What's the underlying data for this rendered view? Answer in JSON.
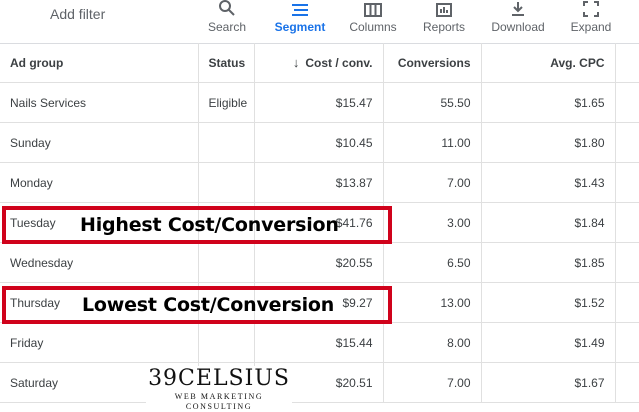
{
  "toolbar": {
    "add_filter": "Add filter",
    "buttons": [
      {
        "label": "Search",
        "icon": "search-icon",
        "active": false
      },
      {
        "label": "Segment",
        "icon": "segment-icon",
        "active": true
      },
      {
        "label": "Columns",
        "icon": "columns-icon",
        "active": false
      },
      {
        "label": "Reports",
        "icon": "reports-icon",
        "active": false
      },
      {
        "label": "Download",
        "icon": "download-icon",
        "active": false
      },
      {
        "label": "Expand",
        "icon": "expand-icon",
        "active": false
      }
    ]
  },
  "table": {
    "headers": {
      "ad_group": "Ad group",
      "status": "Status",
      "cost_conv": "Cost / conv.",
      "conversions": "Conversions",
      "avg_cpc": "Avg. CPC"
    },
    "rows": [
      {
        "ad_group": "Nails Services",
        "status": "Eligible",
        "cost_conv": "$15.47",
        "conversions": "55.50",
        "avg_cpc": "$1.65"
      },
      {
        "ad_group": "Sunday",
        "status": "",
        "cost_conv": "$10.45",
        "conversions": "11.00",
        "avg_cpc": "$1.80"
      },
      {
        "ad_group": "Monday",
        "status": "",
        "cost_conv": "$13.87",
        "conversions": "7.00",
        "avg_cpc": "$1.43"
      },
      {
        "ad_group": "Tuesday",
        "status": "",
        "cost_conv": "$41.76",
        "conversions": "3.00",
        "avg_cpc": "$1.84"
      },
      {
        "ad_group": "Wednesday",
        "status": "",
        "cost_conv": "$20.55",
        "conversions": "6.50",
        "avg_cpc": "$1.85"
      },
      {
        "ad_group": "Thursday",
        "status": "",
        "cost_conv": "$9.27",
        "conversions": "13.00",
        "avg_cpc": "$1.52"
      },
      {
        "ad_group": "Friday",
        "status": "",
        "cost_conv": "$15.44",
        "conversions": "8.00",
        "avg_cpc": "$1.49"
      },
      {
        "ad_group": "Saturday",
        "status": "",
        "cost_conv": "$20.51",
        "conversions": "7.00",
        "avg_cpc": "$1.67"
      }
    ]
  },
  "annotations": {
    "highest": "Highest Cost/Conversion",
    "lowest": "Lowest Cost/Conversion",
    "highlight_color": "#d0021b"
  },
  "watermark": {
    "main": "39CELSIUS",
    "sub": "WEB MARKETING CONSULTING"
  },
  "colors": {
    "accent": "#1a73e8",
    "text": "#3c4043",
    "muted": "#5f6368",
    "border": "#e0e0e0"
  }
}
